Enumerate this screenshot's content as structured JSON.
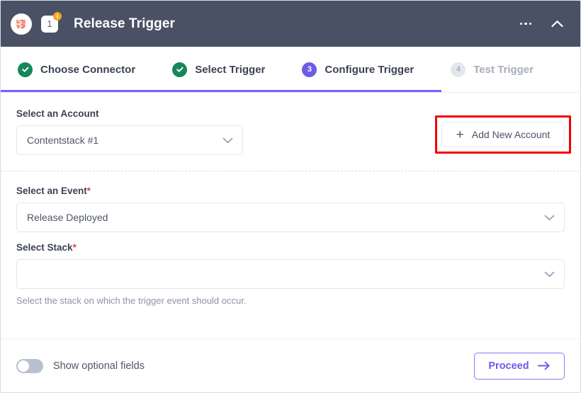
{
  "header": {
    "logo_icon": "contentstack-logo-icon",
    "step_number_badge": "1",
    "info_badge": "i",
    "title": "Release Trigger",
    "more_icon": "ellipsis-icon",
    "collapse_icon": "chevron-up-icon"
  },
  "stepper": {
    "progress_percent": 76,
    "active_color": "#6c5ce7",
    "done_color": "#16875a",
    "steps": [
      {
        "label": "Choose Connector",
        "state": "done",
        "marker": "check"
      },
      {
        "label": "Select Trigger",
        "state": "done",
        "marker": "check"
      },
      {
        "label": "Configure Trigger",
        "state": "active",
        "marker": "3"
      },
      {
        "label": "Test Trigger",
        "state": "todo",
        "marker": "4"
      }
    ]
  },
  "account_section": {
    "label": "Select an Account",
    "selected_value": "Contentstack #1",
    "caret_icon": "chevron-down-icon",
    "add_account": {
      "label": "Add New Account",
      "plus_icon": "plus-icon",
      "highlight_color": "#f40000"
    }
  },
  "fields_section": {
    "event": {
      "label": "Select an Event",
      "required_marker": "*",
      "selected_value": "Release Deployed",
      "caret_icon": "chevron-down-icon"
    },
    "stack": {
      "label": "Select Stack",
      "required_marker": "*",
      "selected_value": "",
      "caret_icon": "chevron-down-icon",
      "helper_text": "Select the stack on which the trigger event should occur."
    }
  },
  "footer": {
    "toggle": {
      "label": "Show optional fields",
      "state": "off"
    },
    "proceed": {
      "label": "Proceed",
      "arrow_icon": "arrow-right-icon",
      "color": "#6c5ce7"
    }
  }
}
